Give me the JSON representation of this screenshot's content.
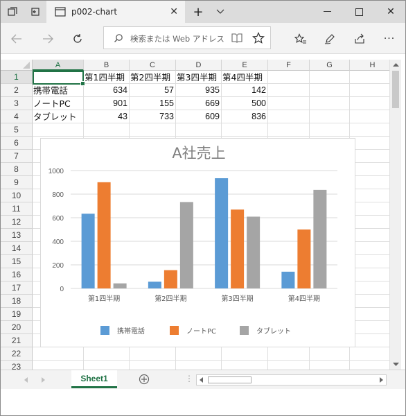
{
  "browser": {
    "tab_title": "p002-chart",
    "address_placeholder": "検索または Web アドレス"
  },
  "sheet": {
    "columns": [
      "A",
      "B",
      "C",
      "D",
      "E",
      "F",
      "G",
      "H"
    ],
    "rows": [
      "1",
      "2",
      "3",
      "4",
      "5",
      "6",
      "7",
      "8",
      "9",
      "10",
      "11",
      "12",
      "13",
      "14",
      "15",
      "16",
      "17",
      "18",
      "19",
      "20",
      "21",
      "22",
      "23"
    ],
    "headers": [
      "第1四半期",
      "第2四半期",
      "第3四半期",
      "第4四半期"
    ],
    "data": [
      {
        "label": "携帯電話",
        "values": [
          "634",
          "57",
          "935",
          "142"
        ]
      },
      {
        "label": "ノートPC",
        "values": [
          "901",
          "155",
          "669",
          "500"
        ]
      },
      {
        "label": "タブレット",
        "values": [
          "43",
          "733",
          "609",
          "836"
        ]
      }
    ],
    "active_cell": "A1",
    "tab_name": "Sheet1"
  },
  "colors": {
    "series_blue": "#5b9bd5",
    "series_orange": "#ed7d31",
    "series_gray": "#a5a5a5",
    "excel_green": "#217346"
  },
  "chart_data": {
    "type": "bar",
    "title": "A社売上",
    "categories": [
      "第1四半期",
      "第2四半期",
      "第3四半期",
      "第4四半期"
    ],
    "series": [
      {
        "name": "携帯電話",
        "values": [
          634,
          57,
          935,
          142
        ]
      },
      {
        "name": "ノートPC",
        "values": [
          901,
          155,
          669,
          500
        ]
      },
      {
        "name": "タブレット",
        "values": [
          43,
          733,
          609,
          836
        ]
      }
    ],
    "yticks": [
      "0",
      "200",
      "400",
      "600",
      "800",
      "1000"
    ],
    "ylim": [
      0,
      1000
    ],
    "grid": true,
    "legend": "bottom"
  }
}
